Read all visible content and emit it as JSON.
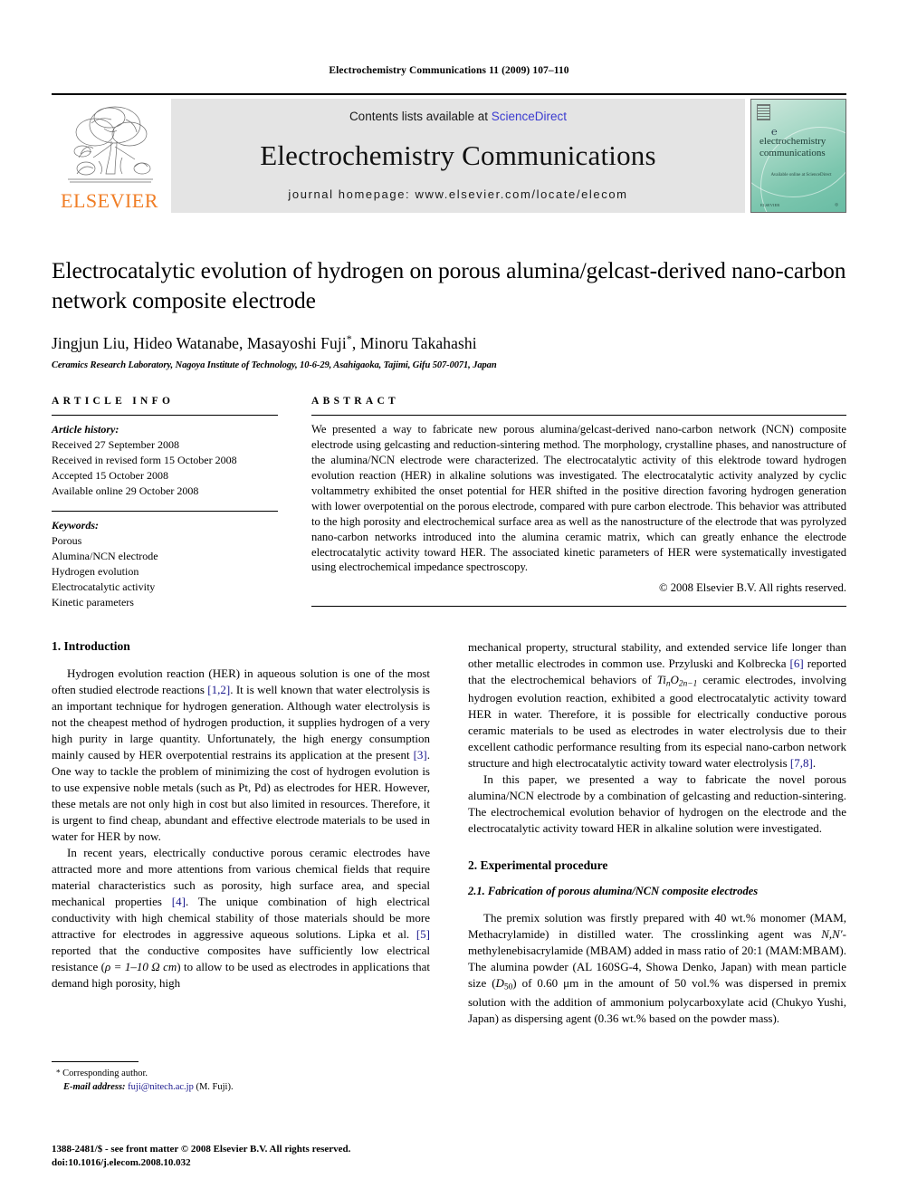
{
  "running_head": "Electrochemistry Communications 11 (2009) 107–110",
  "masthead": {
    "publisher_name": "ELSEVIER",
    "contents_prefix": "Contents lists available at ",
    "sciencedirect": "ScienceDirect",
    "journal_title": "Electrochemistry Communications",
    "homepage": "journal homepage: www.elsevier.com/locate/elecom",
    "cover": {
      "at_glyph": "℮",
      "line1": "electrochemistry",
      "line2": "communications",
      "sub": "Available online at\nScienceDirect",
      "bottom_left": "ELSEVIER",
      "bottom_right": "◎"
    },
    "colors": {
      "band_bg": "#e4e4e4",
      "link_blue": "#3b3bd0",
      "elsevier_orange": "#f07e26",
      "cover_teal": "#7cc6ae"
    }
  },
  "title": "Electrocatalytic evolution of hydrogen on porous alumina/gelcast-derived nano-carbon network composite electrode",
  "authors": "Jingjun Liu, Hideo Watanabe, Masayoshi Fuji",
  "authors_tail": ", Minoru Takahashi",
  "corresponding_marker": "*",
  "affiliation": "Ceramics Research Laboratory, Nagoya Institute of Technology, 10-6-29, Asahigaoka, Tajimi, Gifu 507-0071, Japan",
  "article_info": {
    "heading": "ARTICLE INFO",
    "history_label": "Article history:",
    "history": [
      "Received 27 September 2008",
      "Received in revised form 15 October 2008",
      "Accepted 15 October 2008",
      "Available online 29 October 2008"
    ],
    "keywords_label": "Keywords:",
    "keywords": [
      "Porous",
      "Alumina/NCN electrode",
      "Hydrogen evolution",
      "Electrocatalytic activity",
      "Kinetic parameters"
    ]
  },
  "abstract": {
    "heading": "ABSTRACT",
    "text": "We presented a way to fabricate new porous alumina/gelcast-derived nano-carbon network (NCN) composite electrode using gelcasting and reduction-sintering method. The morphology, crystalline phases, and nanostructure of the alumina/NCN electrode were characterized. The electrocatalytic activity of this elektrode toward hydrogen evolution reaction (HER) in alkaline solutions was investigated. The electrocatalytic activity analyzed by cyclic voltammetry exhibited the onset potential for HER shifted in the positive direction favoring hydrogen generation with lower overpotential on the porous electrode, compared with pure carbon electrode. This behavior was attributed to the high porosity and electrochemical surface area as well as the nanostructure of the electrode that was pyrolyzed nano-carbon networks introduced into the alumina ceramic matrix, which can greatly enhance the electrode electrocatalytic activity toward HER. The associated kinetic parameters of HER were systematically investigated using electrochemical impedance spectroscopy.",
    "copyright": "© 2008 Elsevier B.V. All rights reserved."
  },
  "sections": {
    "intro_heading": "1. Introduction",
    "experimental_heading": "2. Experimental procedure",
    "experimental_sub_heading": "2.1. Fabrication of porous alumina/NCN composite electrodes"
  },
  "paragraphs": {
    "intro_p1_a": "Hydrogen evolution reaction (HER) in aqueous solution is one of the most often studied electrode reactions ",
    "intro_p1_cite1": "[1,2]",
    "intro_p1_b": ". It is well known that water electrolysis is an important technique for hydrogen generation. Although water electrolysis is not the cheapest method of hydrogen production, it supplies hydrogen of a very high purity in large quantity. Unfortunately, the high energy consumption mainly caused by HER overpotential restrains its application at the present ",
    "intro_p1_cite2": "[3]",
    "intro_p1_c": ". One way to tackle the problem of minimizing the cost of hydrogen evolution is to use expensive noble metals (such as Pt, Pd) as electrodes for HER. However, these metals are not only high in cost but also limited in resources. Therefore, it is urgent to find cheap, abundant and effective electrode materials to be used in water for HER by now.",
    "intro_p2_a": "In recent years, electrically conductive porous ceramic electrodes have attracted more and more attentions from various chemical fields that require material characteristics such as porosity, high surface area, and special mechanical properties ",
    "intro_p2_cite1": "[4]",
    "intro_p2_b": ". The unique combination of high electrical conductivity with high chemical stability of those materials should be more attractive for electrodes in aggressive aqueous solutions. Lipka et al. ",
    "intro_p2_cite2": "[5]",
    "intro_p2_c": " reported that the conductive composites have sufficiently low electrical resistance (",
    "intro_p2_math": "ρ = 1–10 Ω cm",
    "intro_p2_d": ") to allow to be used as electrodes in applications that demand high porosity, high",
    "intro_p3_a": "mechanical property, structural stability, and extended service life longer than other metallic electrodes in common use. Przyluski and Kolbrecka ",
    "intro_p3_cite1": "[6]",
    "intro_p3_b": " reported that the electrochemical behaviors of ",
    "intro_p3_formula_1": "Ti",
    "intro_p3_formula_sub1": "n",
    "intro_p3_formula_2": "O",
    "intro_p3_formula_sub2": "2n−1",
    "intro_p3_c": " ceramic electrodes, involving hydrogen evolution reaction, exhibited a good electrocatalytic activity toward HER in water. Therefore, it is possible for electrically conductive porous ceramic materials to be used as electrodes in water electrolysis due to their excellent cathodic performance resulting from its especial nano-carbon network structure and high electrocatalytic activity toward water electrolysis ",
    "intro_p3_cite2": "[7,8]",
    "intro_p3_d": ".",
    "intro_p4": "In this paper, we presented a way to fabricate the novel porous alumina/NCN electrode by a combination of gelcasting and reduction-sintering. The electrochemical evolution behavior of hydrogen on the electrode and the electrocatalytic activity toward HER in alkaline solution were investigated.",
    "exp_p1_a": "The premix solution was firstly prepared with 40 wt.% monomer (MAM, Methacrylamide) in distilled water. The crosslinking agent was ",
    "exp_p1_italic": "N,N′",
    "exp_p1_b": "-methylenebisacrylamide (MBAM) added in mass ratio of 20:1 (MAM:MBAM). The alumina powder (AL 160SG-4, Showa Denko, Japan) with mean particle size (",
    "exp_p1_d50": "D",
    "exp_p1_d50_sub": "50",
    "exp_p1_c": ") of 0.60 μm in the amount of 50 vol.% was dispersed in premix solution with the addition of ammonium polycarboxylate acid (Chukyo Yushi, Japan) as dispersing agent (0.36 wt.% based on the powder mass)."
  },
  "footnote": {
    "star": "*",
    "corresponding": "Corresponding author.",
    "email_label": "E-mail address:",
    "email": "fuji@nitech.ac.jp",
    "email_suffix": "(M. Fuji)."
  },
  "footer": {
    "line1": "1388-2481/$ - see front matter © 2008 Elsevier B.V. All rights reserved.",
    "line2": "doi:10.1016/j.elecom.2008.10.032"
  }
}
